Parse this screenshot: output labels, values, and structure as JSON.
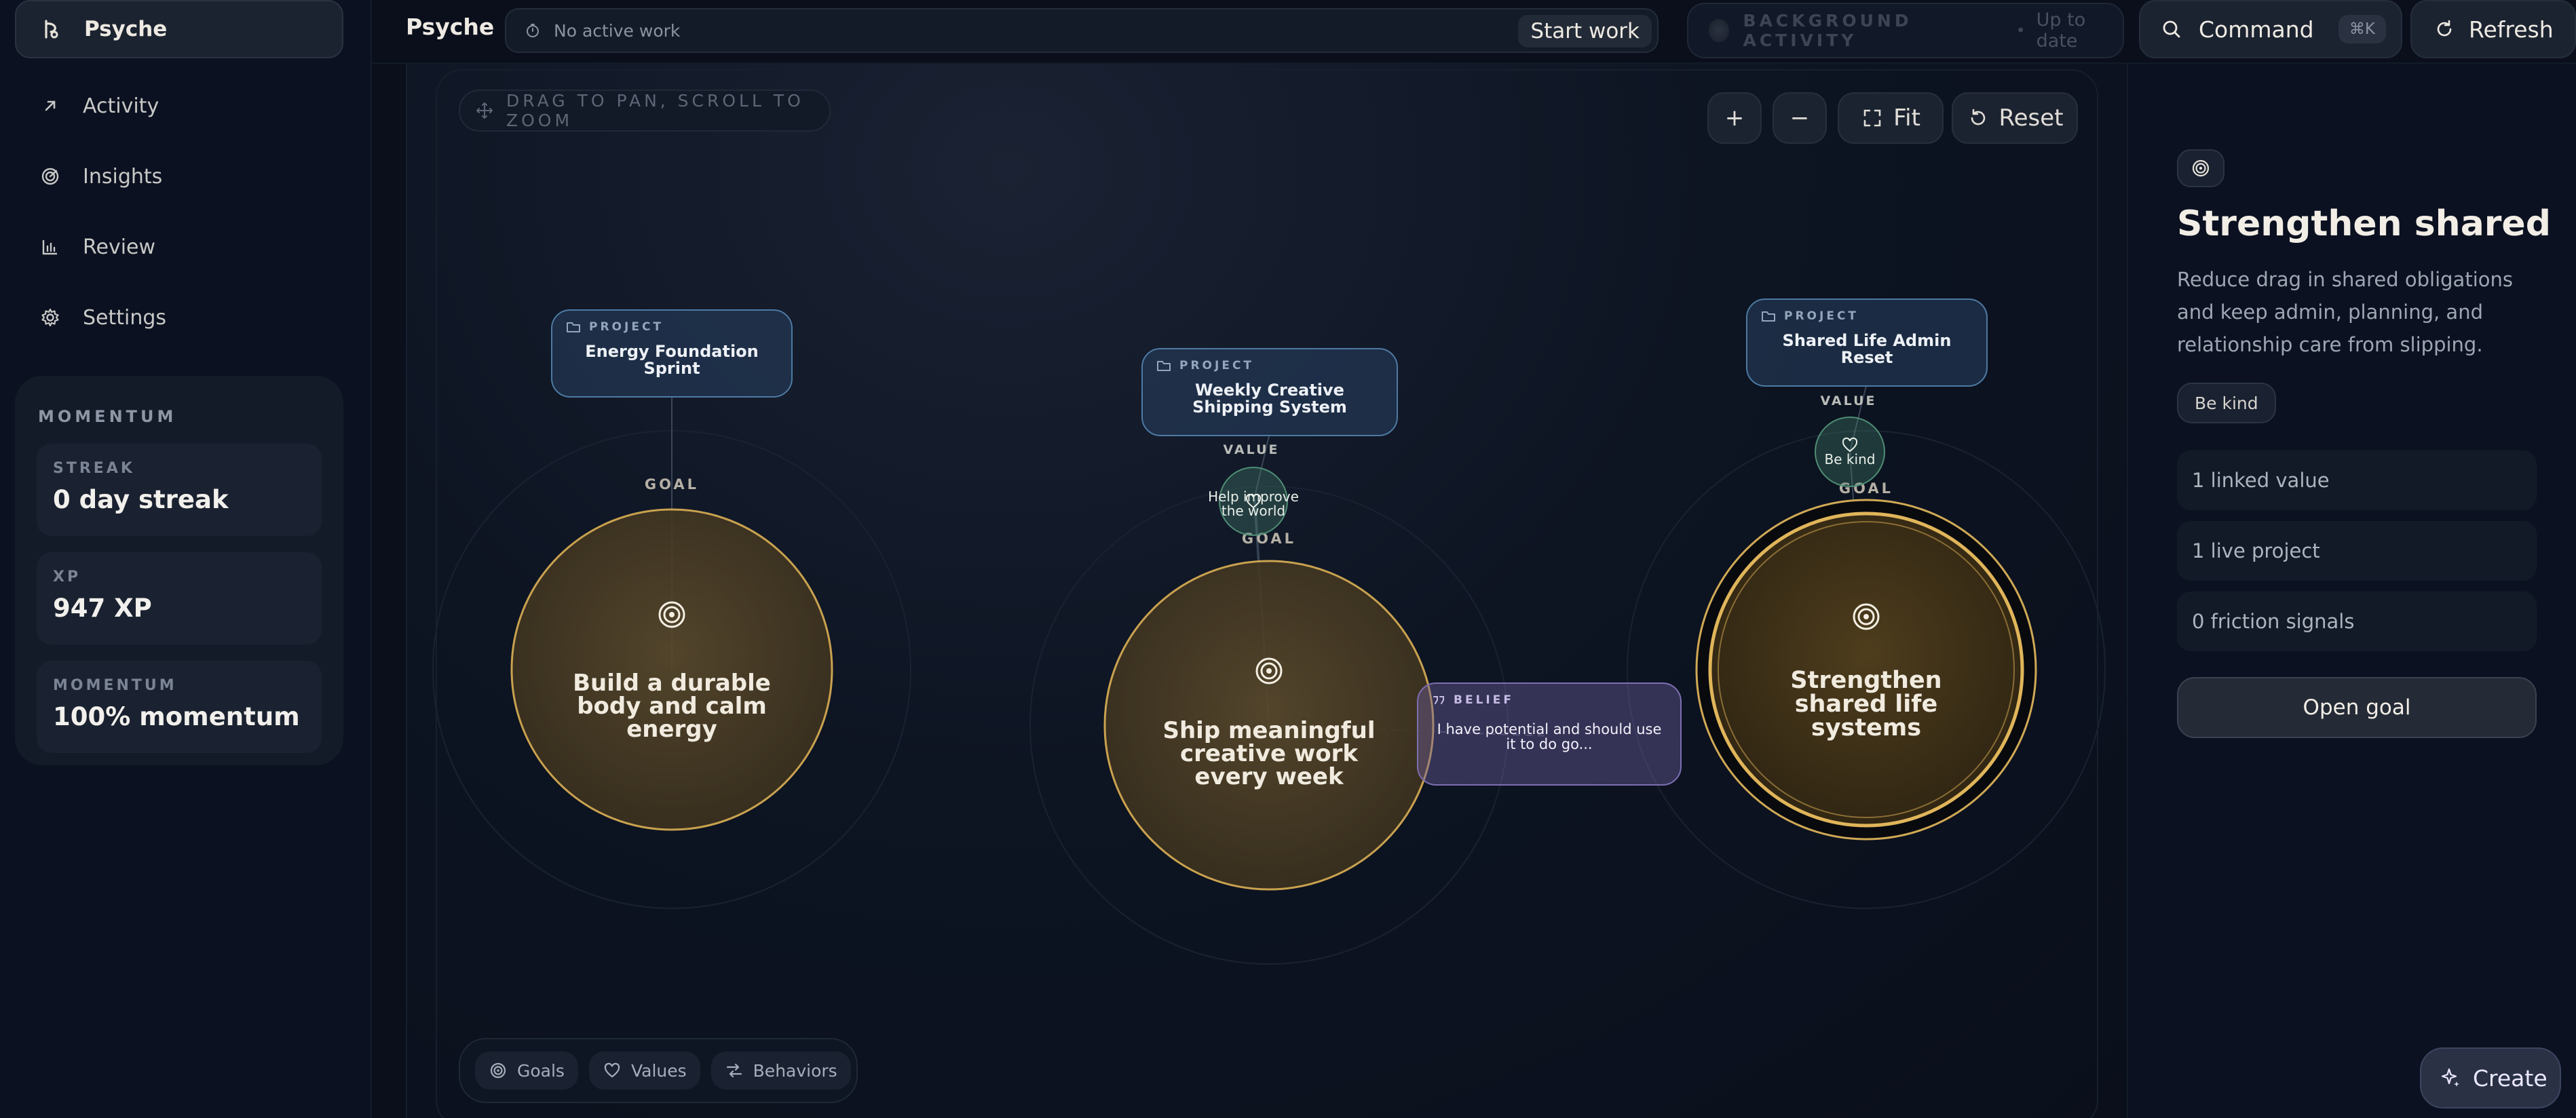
{
  "sidebar": {
    "brand": "Psyche",
    "items": [
      {
        "label": "Activity",
        "icon": "arrow-up-right-icon"
      },
      {
        "label": "Insights",
        "icon": "radar-icon"
      },
      {
        "label": "Review",
        "icon": "bar-chart-icon"
      },
      {
        "label": "Settings",
        "icon": "gear-icon"
      }
    ],
    "momentum": {
      "title": "MOMENTUM",
      "stats": [
        {
          "label": "STREAK",
          "value": "0 day streak"
        },
        {
          "label": "XP",
          "value": "947 XP"
        },
        {
          "label": "MOMENTUM",
          "value": "100% momentum"
        }
      ]
    }
  },
  "topbar": {
    "title": "Psyche",
    "status": "No active work",
    "start": "Start work",
    "background_label": "BACKGROUND ACTIVITY",
    "background_sep": "•",
    "background_status": "Up to date",
    "command": "Command",
    "command_kbd": "⌘K",
    "refresh": "Refresh"
  },
  "canvas": {
    "hint": "DRAG TO PAN, SCROLL TO ZOOM",
    "zoom_in": "+",
    "zoom_out": "−",
    "fit": "Fit",
    "reset": "Reset",
    "legend": [
      {
        "label": "Goals",
        "icon": "target-icon"
      },
      {
        "label": "Values",
        "icon": "heart-icon"
      },
      {
        "label": "Behaviors",
        "icon": "behaviors-icon"
      }
    ],
    "goal_kind": "GOAL",
    "value_kind": "VALUE",
    "project_kind": "PROJECT",
    "belief_kind": "BELIEF",
    "goals": [
      {
        "title": "Build a durable body and calm energy"
      },
      {
        "title": "Ship meaningful creative work every week"
      },
      {
        "title": "Strengthen shared life systems",
        "selected": true
      }
    ],
    "projects": [
      {
        "title": "Energy Foundation Sprint"
      },
      {
        "title": "Weekly Creative Shipping System"
      },
      {
        "title": "Shared Life Admin Reset"
      }
    ],
    "values": [
      {
        "title": "Help improve the world"
      },
      {
        "title": "Be kind"
      }
    ],
    "beliefs": [
      {
        "title": "I have potential and should use it to do go..."
      }
    ]
  },
  "detail": {
    "title": "Strengthen shared lif...",
    "description": "Reduce drag in shared obligations and keep admin, planning, and relationship care from slipping.",
    "tag": "Be kind",
    "rows": [
      "1 linked value",
      "1 live project",
      "0 friction signals"
    ],
    "open": "Open goal"
  },
  "create": "Create",
  "colors": {
    "accent": "#d6ad5a",
    "project": "#4d7aa3",
    "value": "#4e8d74",
    "belief": "#7c6fb1"
  }
}
